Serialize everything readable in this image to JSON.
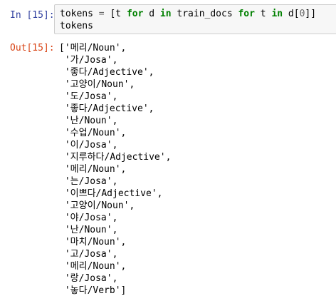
{
  "input_cell": {
    "prompt": "In [15]:",
    "code": {
      "line1": {
        "var": "tokens ",
        "eq": "=",
        "open": " [t ",
        "for1": "for",
        "d": " d ",
        "in1": "in",
        "train": " train_docs ",
        "for2": "for",
        "t": " t ",
        "in2": "in",
        "dpart": " d[",
        "zero": "0",
        "close": "]]"
      },
      "line2": "tokens"
    }
  },
  "output_cell": {
    "prompt": "Out[15]:",
    "lines": [
      "['메리/Noun',",
      " '가/Josa',",
      " '좋다/Adjective',",
      " '고양이/Noun',",
      " '도/Josa',",
      " '좋다/Adjective',",
      " '난/Noun',",
      " '수업/Noun',",
      " '이/Josa',",
      " '지루하다/Adjective',",
      " '메리/Noun',",
      " '는/Josa',",
      " '이쁘다/Adjective',",
      " '고양이/Noun',",
      " '야/Josa',",
      " '난/Noun',",
      " '마치/Noun',",
      " '고/Josa',",
      " '메리/Noun',",
      " '랑/Josa',",
      " '놓다/Verb']"
    ]
  },
  "colors": {
    "in_prompt": "#303f9f",
    "out_prompt": "#d84315",
    "keyword": "#008000",
    "input_bg": "#f7f7f7",
    "input_border": "#cfcfcf"
  }
}
